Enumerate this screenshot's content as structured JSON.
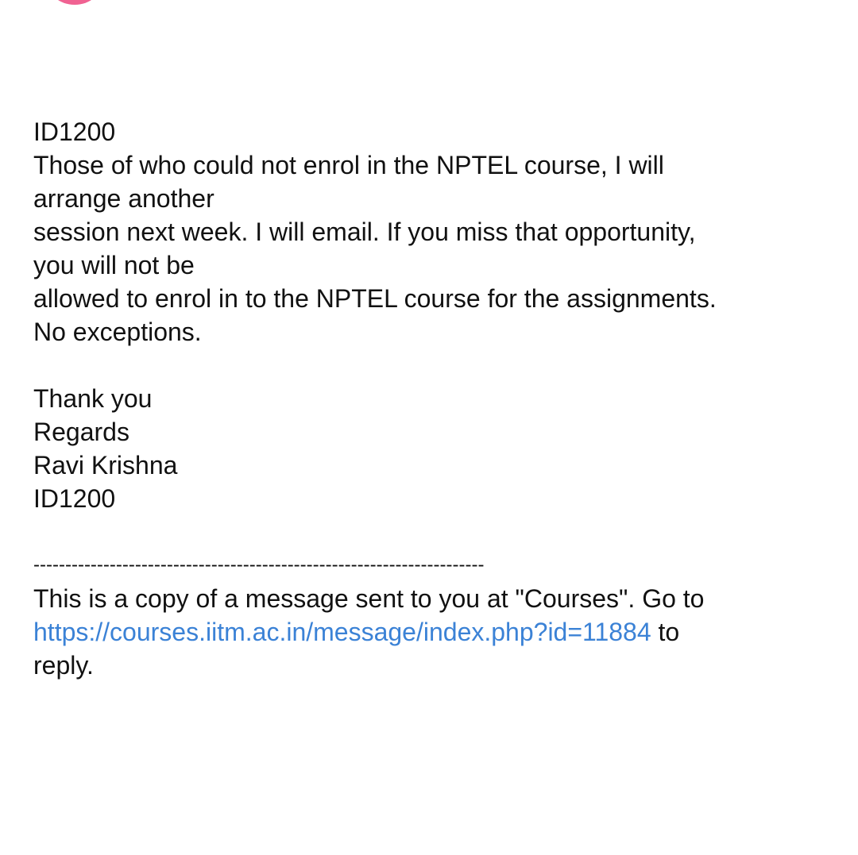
{
  "avatar": {
    "color": "#f06292",
    "icon": "avatar-circle"
  },
  "message": {
    "subject_line": "ID1200",
    "body_lines": [
      "Those of who could not enrol in the NPTEL course, I will",
      "arrange another",
      "session next week. I will email. If you miss that opportunity,",
      "you will not be",
      "allowed to enrol in to the NPTEL course for the assignments.",
      "No exceptions."
    ],
    "closing_lines": [
      "Thank you",
      "Regards",
      "Ravi Krishna",
      "ID1200"
    ],
    "divider": "-----------------------------------------------------------------------",
    "footer": {
      "line1": "This is a copy of a message sent to you at \"Courses\". Go to",
      "link": "https://courses.iitm.ac.in/message/index.php?id=11884",
      "after_link": " to",
      "line3": "reply."
    }
  }
}
